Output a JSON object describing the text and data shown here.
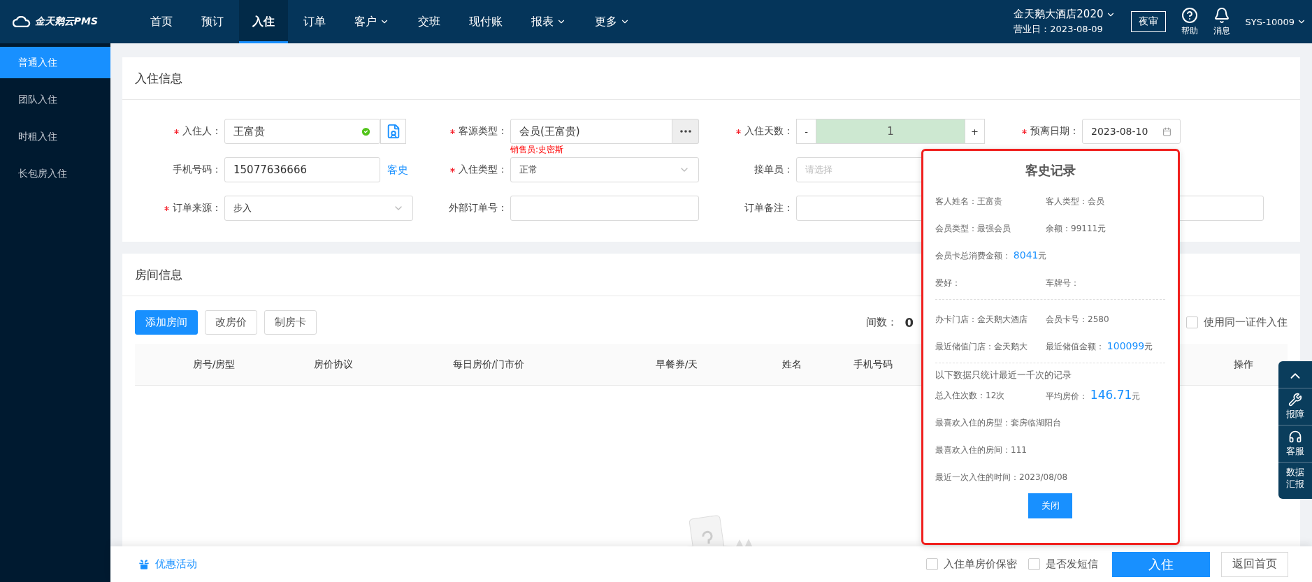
{
  "top_bar": {
    "logo": "金天鹅云PMS",
    "nav": [
      {
        "label": "首页",
        "selected": false,
        "dropdown": false
      },
      {
        "label": "预订",
        "selected": false,
        "dropdown": false
      },
      {
        "label": "入住",
        "selected": true,
        "dropdown": false
      },
      {
        "label": "订单",
        "selected": false,
        "dropdown": false
      },
      {
        "label": "客户",
        "selected": false,
        "dropdown": true
      },
      {
        "label": "交班",
        "selected": false,
        "dropdown": false
      },
      {
        "label": "现付账",
        "selected": false,
        "dropdown": false
      },
      {
        "label": "报表",
        "selected": false,
        "dropdown": true
      },
      {
        "label": "更多",
        "selected": false,
        "dropdown": true
      }
    ],
    "hotel": "金天鹅大酒店2020",
    "business_day": "营业日：2023-08-09",
    "night_audit": "夜审",
    "help": "帮助",
    "messages": "消息",
    "user": "SYS-10009"
  },
  "sidebar": {
    "items": [
      {
        "label": "普通入住",
        "selected": true
      },
      {
        "label": "团队入住",
        "selected": false
      },
      {
        "label": "时租入住",
        "selected": false
      },
      {
        "label": "长包房入住",
        "selected": false
      }
    ]
  },
  "checkin_info": {
    "title": "入住信息",
    "rows": [
      [
        {
          "kind": "guest",
          "label": "入住人：",
          "required": true,
          "value": "王富贵",
          "verified": true
        },
        {
          "kind": "picker",
          "label": "客源类型：",
          "required": true,
          "value": "会员(王富贵)",
          "note": "销售员:史密斯"
        },
        {
          "kind": "stepper",
          "label": "入住天数：",
          "required": true,
          "minus": "-",
          "value": "1",
          "plus": "+"
        },
        {
          "kind": "date",
          "label": "预离日期：",
          "required": true,
          "value": "2023-08-10"
        }
      ],
      [
        {
          "kind": "phone",
          "label": "手机号码：",
          "required": false,
          "value": "15077636666",
          "link": "客史"
        },
        {
          "kind": "select",
          "label": "入住类型：",
          "required": true,
          "value": "正常"
        },
        {
          "kind": "select",
          "label": "接单员：",
          "required": false,
          "placeholder": "请选择"
        }
      ],
      [
        {
          "kind": "select",
          "label": "订单来源：",
          "required": true,
          "value": "步入"
        },
        {
          "kind": "input",
          "label": "外部订单号：",
          "required": false,
          "wide": false
        },
        {
          "kind": "input",
          "label": "订单备注：",
          "required": false,
          "wide": true
        }
      ]
    ]
  },
  "room_info": {
    "title": "房间信息",
    "buttons": [
      {
        "label": "添加房间",
        "primary": true
      },
      {
        "label": "改房价",
        "primary": false
      },
      {
        "label": "制房卡",
        "primary": false
      }
    ],
    "room_count_label": "间数：",
    "room_count": "0",
    "same_id": {
      "label": "使用同一证件入住",
      "checked": false
    },
    "columns": [
      "房号/房型",
      "房价协议",
      "每日房价/门市价",
      "早餐券/天",
      "姓名",
      "手机号码",
      "操作"
    ]
  },
  "history_popup": {
    "title": "客史记录",
    "sections": [
      {
        "rows": [
          [
            {
              "label": "客人姓名：",
              "value": "王富贵",
              "highlight": false
            },
            {
              "label": "客人类型：",
              "value": "会员",
              "highlight": false
            }
          ],
          [
            {
              "label": "会员类型：",
              "value": "最强会员",
              "highlight": false
            },
            {
              "label": "余额：",
              "value": "99111元",
              "highlight": false
            }
          ],
          [
            {
              "label": "会员卡总消费金额：",
              "value": "8041",
              "unit": "元",
              "highlight": true
            }
          ],
          [
            {
              "label": "爱好："
            },
            {
              "label": "车牌号："
            }
          ]
        ]
      },
      {
        "rows": [
          [
            {
              "label": "办卡门店：",
              "value": "金天鹅大酒店",
              "highlight": false
            },
            {
              "label": "会员卡号：",
              "value": "2580",
              "highlight": false
            }
          ],
          [
            {
              "label": "最近储值门店：",
              "value": "金天鹅大",
              "highlight": false
            },
            {
              "label": "最近储值金额：",
              "value": "100099",
              "unit": "元",
              "highlight": true
            }
          ]
        ]
      },
      {
        "note": "以下数据只统计最近一千次的记录",
        "rows": [
          [
            {
              "label": "总入住次数：",
              "value": "12次",
              "highlight": false
            },
            {
              "label": "平均房价：",
              "value": "146.71",
              "unit": "元",
              "highlight": true
            }
          ],
          [
            {
              "label": "最喜欢入住的房型：",
              "value": "套房临湖阳台",
              "highlight": false
            }
          ],
          [
            {
              "label": "最喜欢入住的房间：",
              "value": "111",
              "highlight": false
            }
          ],
          [
            {
              "label": "最近一次入住的时间：",
              "value": "2023/08/08",
              "highlight": false
            }
          ]
        ]
      }
    ],
    "close": "关闭"
  },
  "side_tools": [
    {
      "kind": "top"
    },
    {
      "kind": "repair",
      "label": "报障"
    },
    {
      "kind": "service",
      "label": "客服"
    },
    {
      "kind": "report",
      "label": "数据汇报"
    }
  ],
  "footer": {
    "promo": "优惠活动",
    "options": [
      {
        "label": "入住单房价保密",
        "checked": false
      },
      {
        "label": "是否发短信",
        "checked": false
      }
    ],
    "submit": "入住",
    "back": "返回首页"
  }
}
